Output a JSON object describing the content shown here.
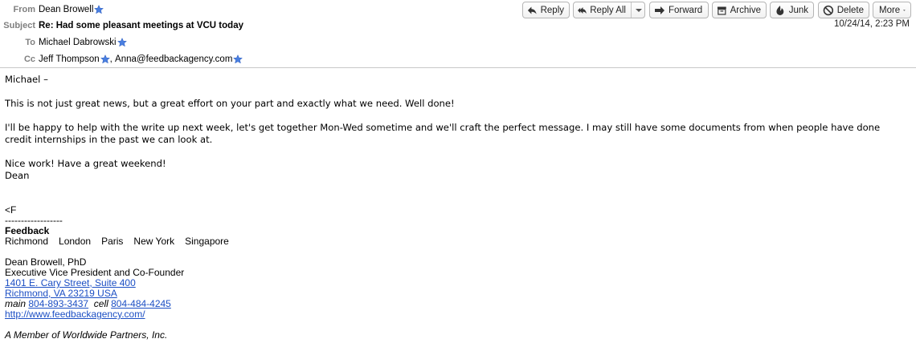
{
  "header": {
    "from_label": "From",
    "from": "Dean Browell",
    "subject_label": "Subject",
    "subject": "Re: Had some pleasant meetings at VCU today",
    "to_label": "To",
    "to": "Michael Dabrowski",
    "cc_label": "Cc",
    "cc": [
      "Jeff Thompson",
      "Anna@feedbackagency.com"
    ],
    "date": "10/24/14, 2:23 PM"
  },
  "toolbar": {
    "reply": "Reply",
    "reply_all": "Reply All",
    "forward": "Forward",
    "archive": "Archive",
    "junk": "Junk",
    "delete": "Delete",
    "more": "More"
  },
  "body": {
    "greeting": "Michael –",
    "p1": "This is not just great news, but a great effort on your part and exactly what we need. Well done!",
    "p2": "I'll be happy to help with the write up next week, let's get together Mon-Wed sometime and we'll craft the perfect message. I may still have some documents from when people have done credit internships in the past we can look at.",
    "p3a": "Nice work! Have a great weekend!",
    "p3b": "Dean"
  },
  "signature": {
    "mark": "<F",
    "rule": "------------------",
    "company": "Feedback",
    "cities": [
      "Richmond",
      "London",
      "Paris",
      "New York",
      "Singapore"
    ],
    "name": "Dean Browell, PhD",
    "title": "Executive Vice President and Co-Founder",
    "address1": "1401 E. Cary Street, Suite 400",
    "address2": "Richmond, VA 23219 USA",
    "main_label": "main",
    "main_phone": "804-893-3437",
    "cell_label": "cell",
    "cell_phone": "804-484-4245",
    "website": "http://www.feedbackagency.com/",
    "member": "A Member of Worldwide Partners, Inc."
  },
  "colors": {
    "star": "#4a7fe0",
    "link": "#1c4fc4",
    "label": "#7f7f7f"
  },
  "icons": [
    "reply-icon",
    "reply-all-icon",
    "forward-icon",
    "archive-icon",
    "junk-icon",
    "delete-icon",
    "star-icon"
  ]
}
